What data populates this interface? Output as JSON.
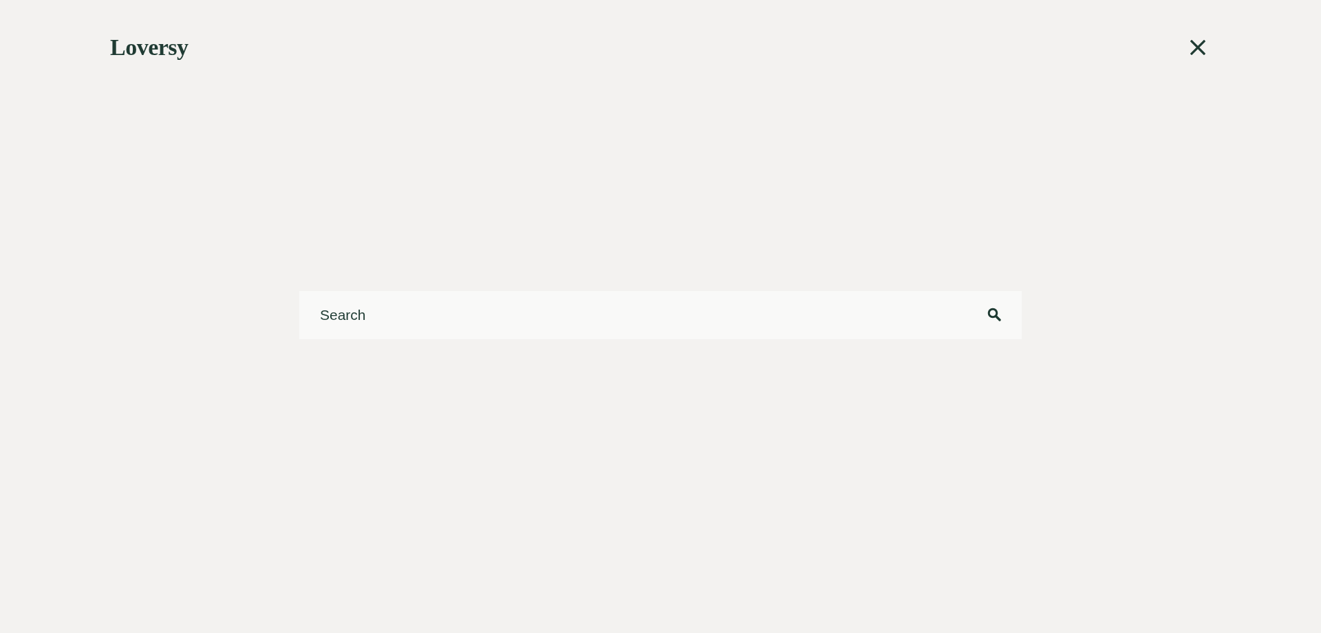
{
  "header": {
    "logo": "Loversy"
  },
  "search": {
    "placeholder": "Search"
  }
}
